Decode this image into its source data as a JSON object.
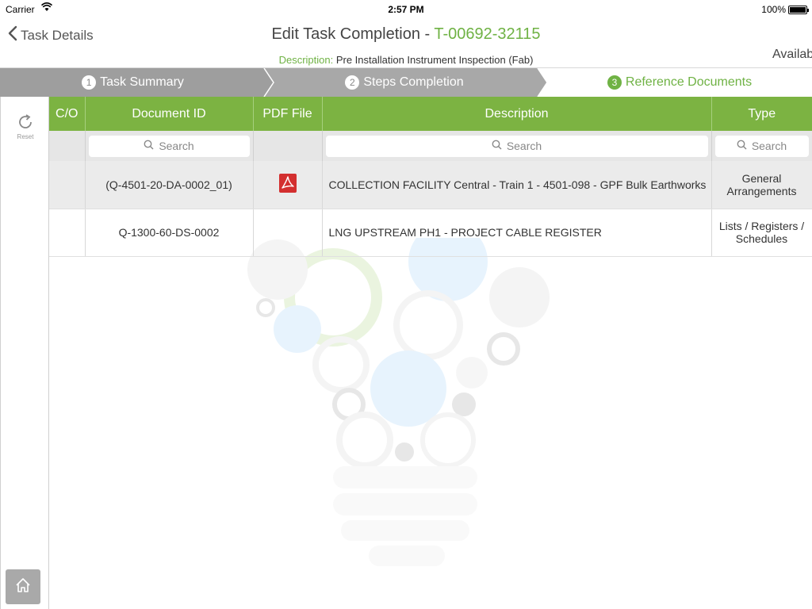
{
  "status_bar": {
    "carrier": "Carrier",
    "time": "2:57 PM",
    "battery": "100%"
  },
  "header": {
    "back_label": "Task Details",
    "title": "Edit Task Completion - ",
    "task_id": "T-00692-32115",
    "description_label": "Description:",
    "description_value": " Pre Installation Instrument Inspection (Fab)",
    "avail_label": "Availab"
  },
  "steps": [
    {
      "number": "1",
      "label": "Task Summary"
    },
    {
      "number": "2",
      "label": "Steps Completion"
    },
    {
      "number": "3",
      "label": "Reference Documents"
    }
  ],
  "left_rail": {
    "reset_label": "Reset",
    "reset_icon": "refresh-icon",
    "home_icon": "home-icon"
  },
  "table": {
    "columns": [
      "C/O",
      "Document ID",
      "PDF File",
      "Description",
      "Type"
    ],
    "search_placeholder": "Search",
    "rows": [
      {
        "co": "",
        "document_id": "(Q-4501-20-DA-0002_01)",
        "pdf": "pdf-icon",
        "description": "COLLECTION FACILITY Central - Train 1 - 4501-098 - GPF Bulk Earthworks",
        "type": "General Arrangements"
      },
      {
        "co": "",
        "document_id": "Q-1300-60-DS-0002",
        "pdf": "",
        "description": "LNG UPSTREAM PH1 - PROJECT CABLE REGISTER",
        "type": "Lists / Registers / Schedules"
      }
    ]
  },
  "colors": {
    "accent_green": "#7cb342",
    "text_green": "#6fb244",
    "pdf_red": "#d32f2f",
    "steps_gray": "#9e9e9e"
  }
}
